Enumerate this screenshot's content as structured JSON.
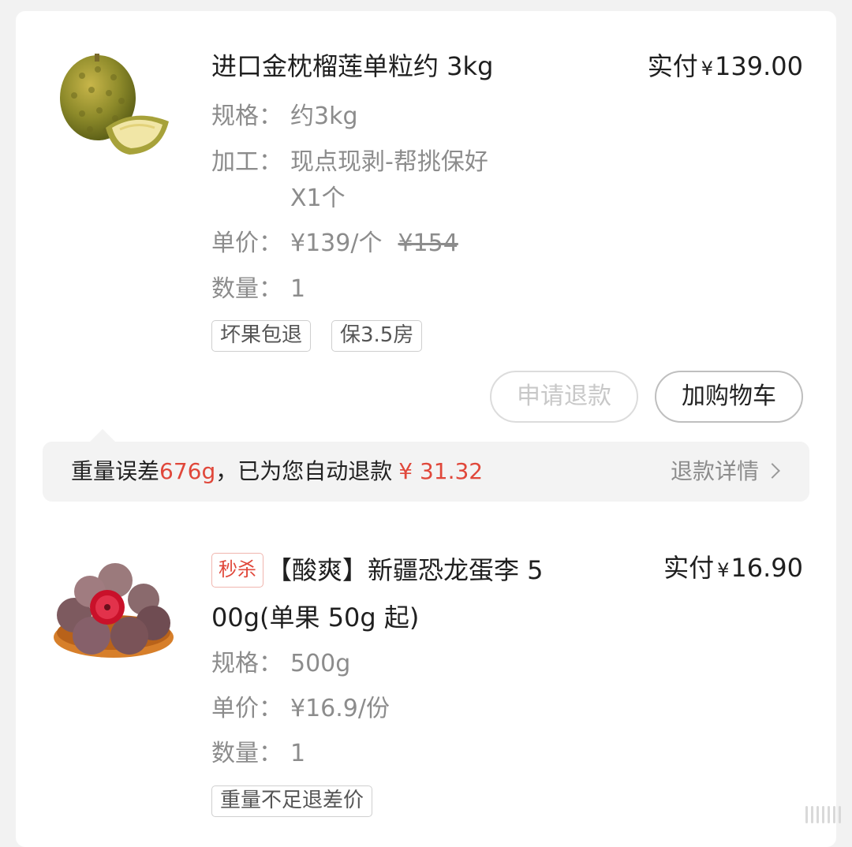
{
  "items": [
    {
      "title": "进口金枕榴莲单粒约 3kg",
      "paid_label": "实付",
      "paid_currency": "¥",
      "paid_amount": "139.00",
      "spec_label": "规格：",
      "spec_value": "约3kg",
      "process_label": "加工：",
      "process_value_line1": "现点现剥-帮挑保好",
      "process_value_line2": "X1个",
      "price_label": "单价：",
      "price_value": "¥139/个",
      "price_original": "¥154",
      "qty_label": "数量：",
      "qty_value": "1",
      "tags": [
        "坏果包退",
        "保3.5房"
      ],
      "buttons": {
        "refund": "申请退款",
        "add_cart": "加购物车"
      },
      "image_icon": "durian-image"
    },
    {
      "flash_badge": "秒杀",
      "title_line1": "【酸爽】新疆恐龙蛋李 5",
      "title_line2": "00g(单果 50g 起)",
      "paid_label": "实付",
      "paid_currency": "¥",
      "paid_amount": "16.90",
      "spec_label": "规格：",
      "spec_value": "500g",
      "price_label": "单价：",
      "price_value": "¥16.9/份",
      "qty_label": "数量：",
      "qty_value": "1",
      "tags": [
        "重量不足退差价"
      ],
      "image_icon": "plum-image"
    }
  ],
  "notice": {
    "prefix": "重量误差",
    "weight": "676g",
    "middle": "，已为您自动退款",
    "amount": "¥ 31.32",
    "link": "退款详情"
  },
  "colors": {
    "accent_red": "#e0473a",
    "muted": "#8c8c8c"
  }
}
